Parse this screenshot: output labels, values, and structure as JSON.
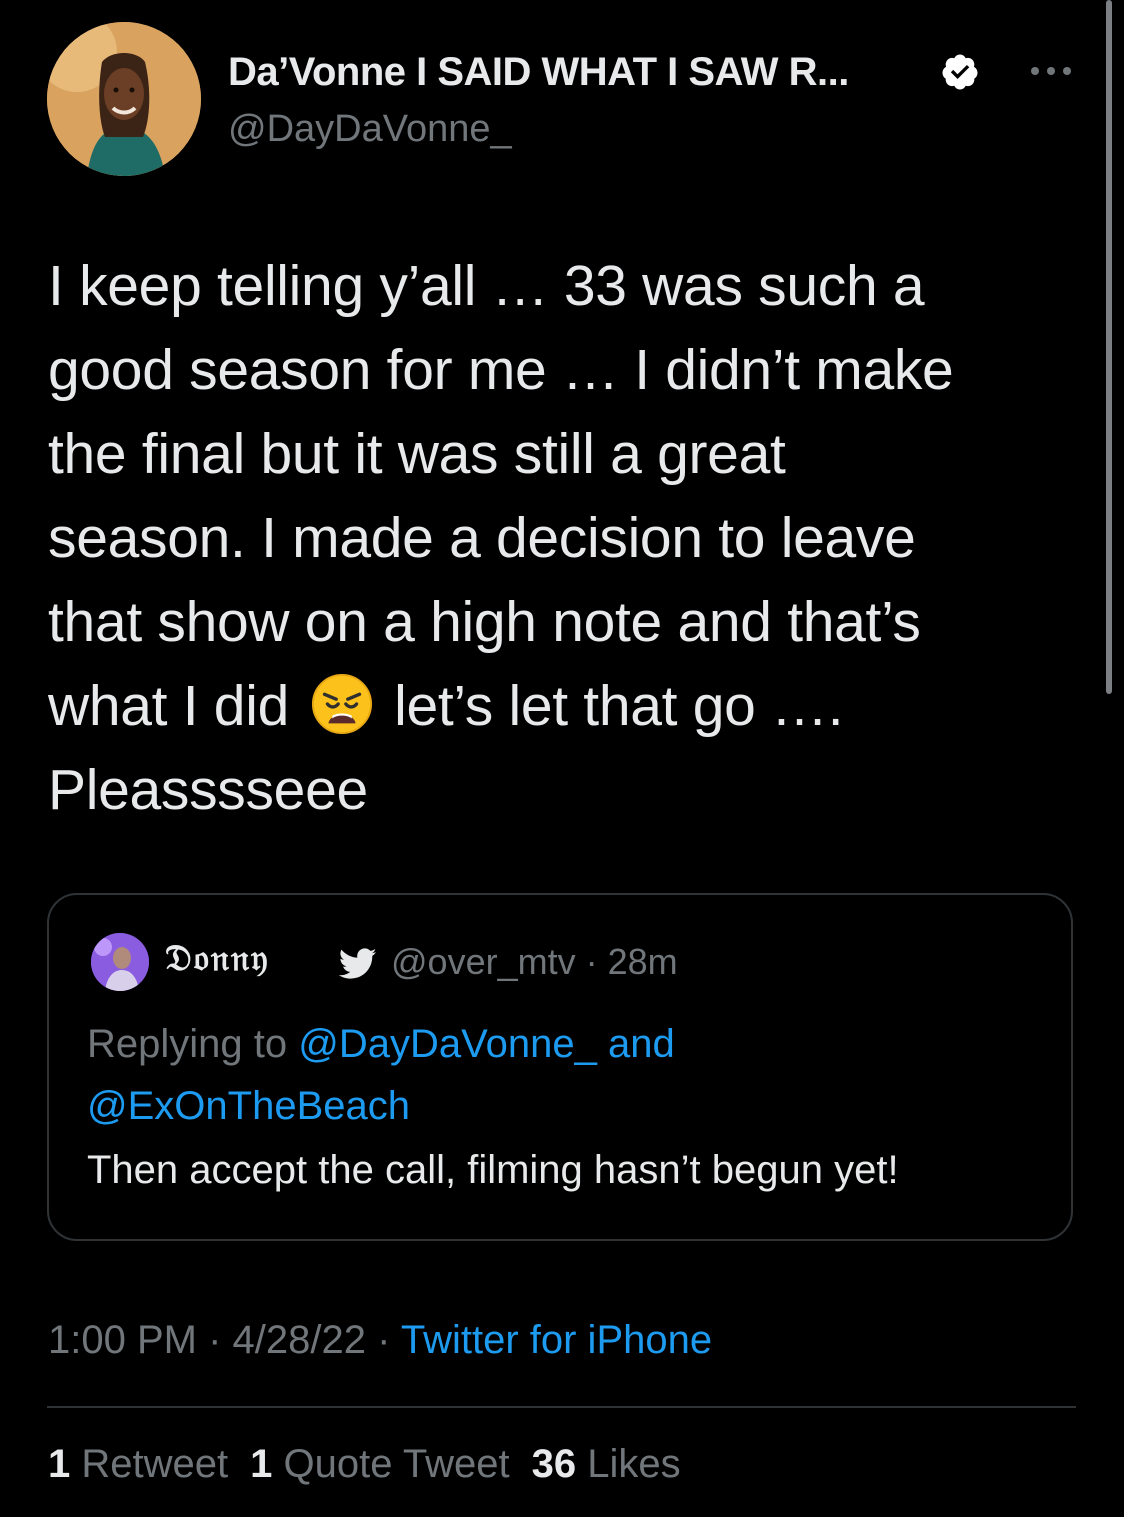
{
  "author": {
    "display_name": "Da’Vonne I SAID WHAT I SAW R...",
    "handle": "@DayDaVonne_",
    "verified": true
  },
  "tweet": {
    "lines": [
      "I keep telling y’all … 33 was such a",
      "good season for me … I didn’t make",
      "the final but it was still a great",
      "season. I made a decision to leave",
      "that show on a high note and that’s",
      "what I did",
      "let’s let that go ….",
      "Pleasssseee"
    ],
    "emoji": "weary-face"
  },
  "quoted_tweet": {
    "display_name": "𝔇𝔬𝔫𝔫𝔶",
    "handle_time": "@over_mtv · 28m",
    "replying_prefix": "Replying to",
    "replying_user1": "@DayDaVonne_",
    "replying_and": "and",
    "replying_user2": "@ExOnTheBeach",
    "text": "Then accept the call, filming hasn’t begun yet!"
  },
  "meta": {
    "time": "1:00 PM",
    "date": "4/28/22",
    "source": "Twitter for iPhone",
    "separator": "·"
  },
  "stats": {
    "retweets_count": "1",
    "retweets_label": "Retweet",
    "quotes_count": "1",
    "quotes_label": "Quote Tweet",
    "likes_count": "36",
    "likes_label": "Likes"
  },
  "colors": {
    "background": "#000000",
    "text": "#e7e9ea",
    "secondary": "#71767b",
    "link": "#1d9bf0",
    "border": "#2f3336"
  }
}
